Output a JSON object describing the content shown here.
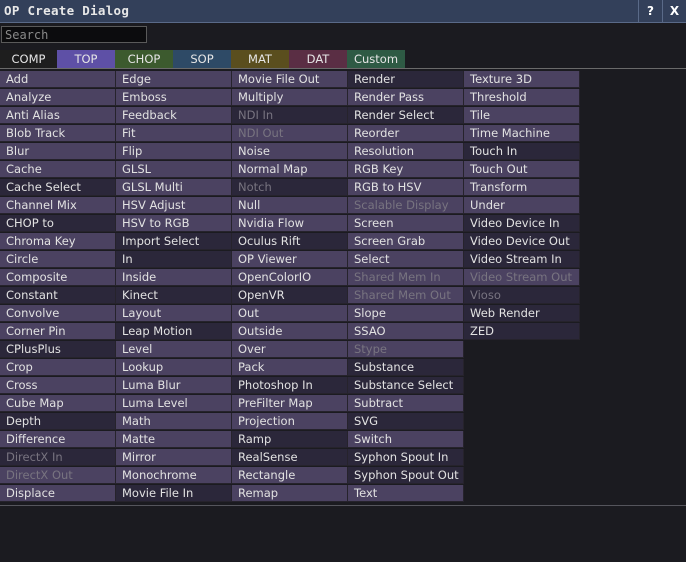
{
  "window": {
    "title": "OP Create Dialog",
    "help_label": "?",
    "close_label": "X"
  },
  "search": {
    "placeholder": "Search",
    "value": ""
  },
  "tabs": [
    {
      "label": "COMP",
      "color": "#1e1e1e",
      "active": false
    },
    {
      "label": "TOP",
      "color": "#5e50a6",
      "active": true
    },
    {
      "label": "CHOP",
      "color": "#3c5a2e",
      "active": false
    },
    {
      "label": "SOP",
      "color": "#2e4a66",
      "active": false
    },
    {
      "label": "MAT",
      "color": "#5a4e1e",
      "active": false
    },
    {
      "label": "DAT",
      "color": "#5a2e44",
      "active": false
    },
    {
      "label": "Custom",
      "color": "#2e5a44",
      "active": false
    }
  ],
  "columns": [
    {
      "items": [
        {
          "label": "Add",
          "variant": 0
        },
        {
          "label": "Analyze",
          "variant": 0
        },
        {
          "label": "Anti Alias",
          "variant": 0
        },
        {
          "label": "Blob Track",
          "variant": 0
        },
        {
          "label": "Blur",
          "variant": 0
        },
        {
          "label": "Cache",
          "variant": 0
        },
        {
          "label": "Cache Select",
          "variant": 1
        },
        {
          "label": "Channel Mix",
          "variant": 0
        },
        {
          "label": "CHOP to",
          "variant": 1
        },
        {
          "label": "Chroma Key",
          "variant": 0
        },
        {
          "label": "Circle",
          "variant": 0
        },
        {
          "label": "Composite",
          "variant": 0
        },
        {
          "label": "Constant",
          "variant": 1
        },
        {
          "label": "Convolve",
          "variant": 0
        },
        {
          "label": "Corner Pin",
          "variant": 0
        },
        {
          "label": "CPlusPlus",
          "variant": 1
        },
        {
          "label": "Crop",
          "variant": 0
        },
        {
          "label": "Cross",
          "variant": 0
        },
        {
          "label": "Cube Map",
          "variant": 0
        },
        {
          "label": "Depth",
          "variant": 1
        },
        {
          "label": "Difference",
          "variant": 0
        },
        {
          "label": "DirectX In",
          "variant": 1,
          "disabled": true
        },
        {
          "label": "DirectX Out",
          "variant": 0,
          "disabled": true
        },
        {
          "label": "Displace",
          "variant": 0
        }
      ]
    },
    {
      "items": [
        {
          "label": "Edge",
          "variant": 0
        },
        {
          "label": "Emboss",
          "variant": 0
        },
        {
          "label": "Feedback",
          "variant": 0
        },
        {
          "label": "Fit",
          "variant": 0
        },
        {
          "label": "Flip",
          "variant": 0
        },
        {
          "label": "GLSL",
          "variant": 0
        },
        {
          "label": "GLSL Multi",
          "variant": 0
        },
        {
          "label": "HSV Adjust",
          "variant": 0
        },
        {
          "label": "HSV to RGB",
          "variant": 0
        },
        {
          "label": "Import Select",
          "variant": 1
        },
        {
          "label": "In",
          "variant": 1
        },
        {
          "label": "Inside",
          "variant": 0
        },
        {
          "label": "Kinect",
          "variant": 1
        },
        {
          "label": "Layout",
          "variant": 0
        },
        {
          "label": "Leap Motion",
          "variant": 1
        },
        {
          "label": "Level",
          "variant": 0
        },
        {
          "label": "Lookup",
          "variant": 0
        },
        {
          "label": "Luma Blur",
          "variant": 0
        },
        {
          "label": "Luma Level",
          "variant": 0
        },
        {
          "label": "Math",
          "variant": 0
        },
        {
          "label": "Matte",
          "variant": 0
        },
        {
          "label": "Mirror",
          "variant": 0
        },
        {
          "label": "Monochrome",
          "variant": 0
        },
        {
          "label": "Movie File In",
          "variant": 1
        }
      ]
    },
    {
      "items": [
        {
          "label": "Movie File Out",
          "variant": 0
        },
        {
          "label": "Multiply",
          "variant": 0
        },
        {
          "label": "NDI In",
          "variant": 1,
          "disabled": true
        },
        {
          "label": "NDI Out",
          "variant": 0,
          "disabled": true
        },
        {
          "label": "Noise",
          "variant": 0
        },
        {
          "label": "Normal Map",
          "variant": 0
        },
        {
          "label": "Notch",
          "variant": 1,
          "disabled": true
        },
        {
          "label": "Null",
          "variant": 0
        },
        {
          "label": "Nvidia Flow",
          "variant": 0
        },
        {
          "label": "Oculus Rift",
          "variant": 1
        },
        {
          "label": "OP Viewer",
          "variant": 0
        },
        {
          "label": "OpenColorIO",
          "variant": 0
        },
        {
          "label": "OpenVR",
          "variant": 1
        },
        {
          "label": "Out",
          "variant": 0
        },
        {
          "label": "Outside",
          "variant": 0
        },
        {
          "label": "Over",
          "variant": 0
        },
        {
          "label": "Pack",
          "variant": 0
        },
        {
          "label": "Photoshop In",
          "variant": 1
        },
        {
          "label": "PreFilter Map",
          "variant": 0
        },
        {
          "label": "Projection",
          "variant": 0
        },
        {
          "label": "Ramp",
          "variant": 1
        },
        {
          "label": "RealSense",
          "variant": 1
        },
        {
          "label": "Rectangle",
          "variant": 0
        },
        {
          "label": "Remap",
          "variant": 0
        }
      ]
    },
    {
      "items": [
        {
          "label": "Render",
          "variant": 1
        },
        {
          "label": "Render Pass",
          "variant": 0
        },
        {
          "label": "Render Select",
          "variant": 1
        },
        {
          "label": "Reorder",
          "variant": 0
        },
        {
          "label": "Resolution",
          "variant": 0
        },
        {
          "label": "RGB Key",
          "variant": 0
        },
        {
          "label": "RGB to HSV",
          "variant": 0
        },
        {
          "label": "Scalable Display",
          "variant": 0,
          "disabled": true
        },
        {
          "label": "Screen",
          "variant": 0
        },
        {
          "label": "Screen Grab",
          "variant": 0
        },
        {
          "label": "Select",
          "variant": 0
        },
        {
          "label": "Shared Mem In",
          "variant": 0,
          "disabled": true
        },
        {
          "label": "Shared Mem Out",
          "variant": 0,
          "disabled": true
        },
        {
          "label": "Slope",
          "variant": 0
        },
        {
          "label": "SSAO",
          "variant": 0
        },
        {
          "label": "Stype",
          "variant": 0,
          "disabled": true
        },
        {
          "label": "Substance",
          "variant": 1
        },
        {
          "label": "Substance Select",
          "variant": 1
        },
        {
          "label": "Subtract",
          "variant": 0
        },
        {
          "label": "SVG",
          "variant": 1
        },
        {
          "label": "Switch",
          "variant": 0
        },
        {
          "label": "Syphon Spout In",
          "variant": 1
        },
        {
          "label": "Syphon Spout Out",
          "variant": 1
        },
        {
          "label": "Text",
          "variant": 0
        }
      ]
    },
    {
      "items": [
        {
          "label": "Texture 3D",
          "variant": 0
        },
        {
          "label": "Threshold",
          "variant": 0
        },
        {
          "label": "Tile",
          "variant": 0
        },
        {
          "label": "Time Machine",
          "variant": 0
        },
        {
          "label": "Touch In",
          "variant": 1
        },
        {
          "label": "Touch Out",
          "variant": 0
        },
        {
          "label": "Transform",
          "variant": 0
        },
        {
          "label": "Under",
          "variant": 0
        },
        {
          "label": "Video Device In",
          "variant": 1
        },
        {
          "label": "Video Device Out",
          "variant": 1
        },
        {
          "label": "Video Stream In",
          "variant": 1
        },
        {
          "label": "Video Stream Out",
          "variant": 0,
          "disabled": true
        },
        {
          "label": "Vioso",
          "variant": 1,
          "disabled": true
        },
        {
          "label": "Web Render",
          "variant": 1
        },
        {
          "label": "ZED",
          "variant": 1
        }
      ]
    }
  ]
}
